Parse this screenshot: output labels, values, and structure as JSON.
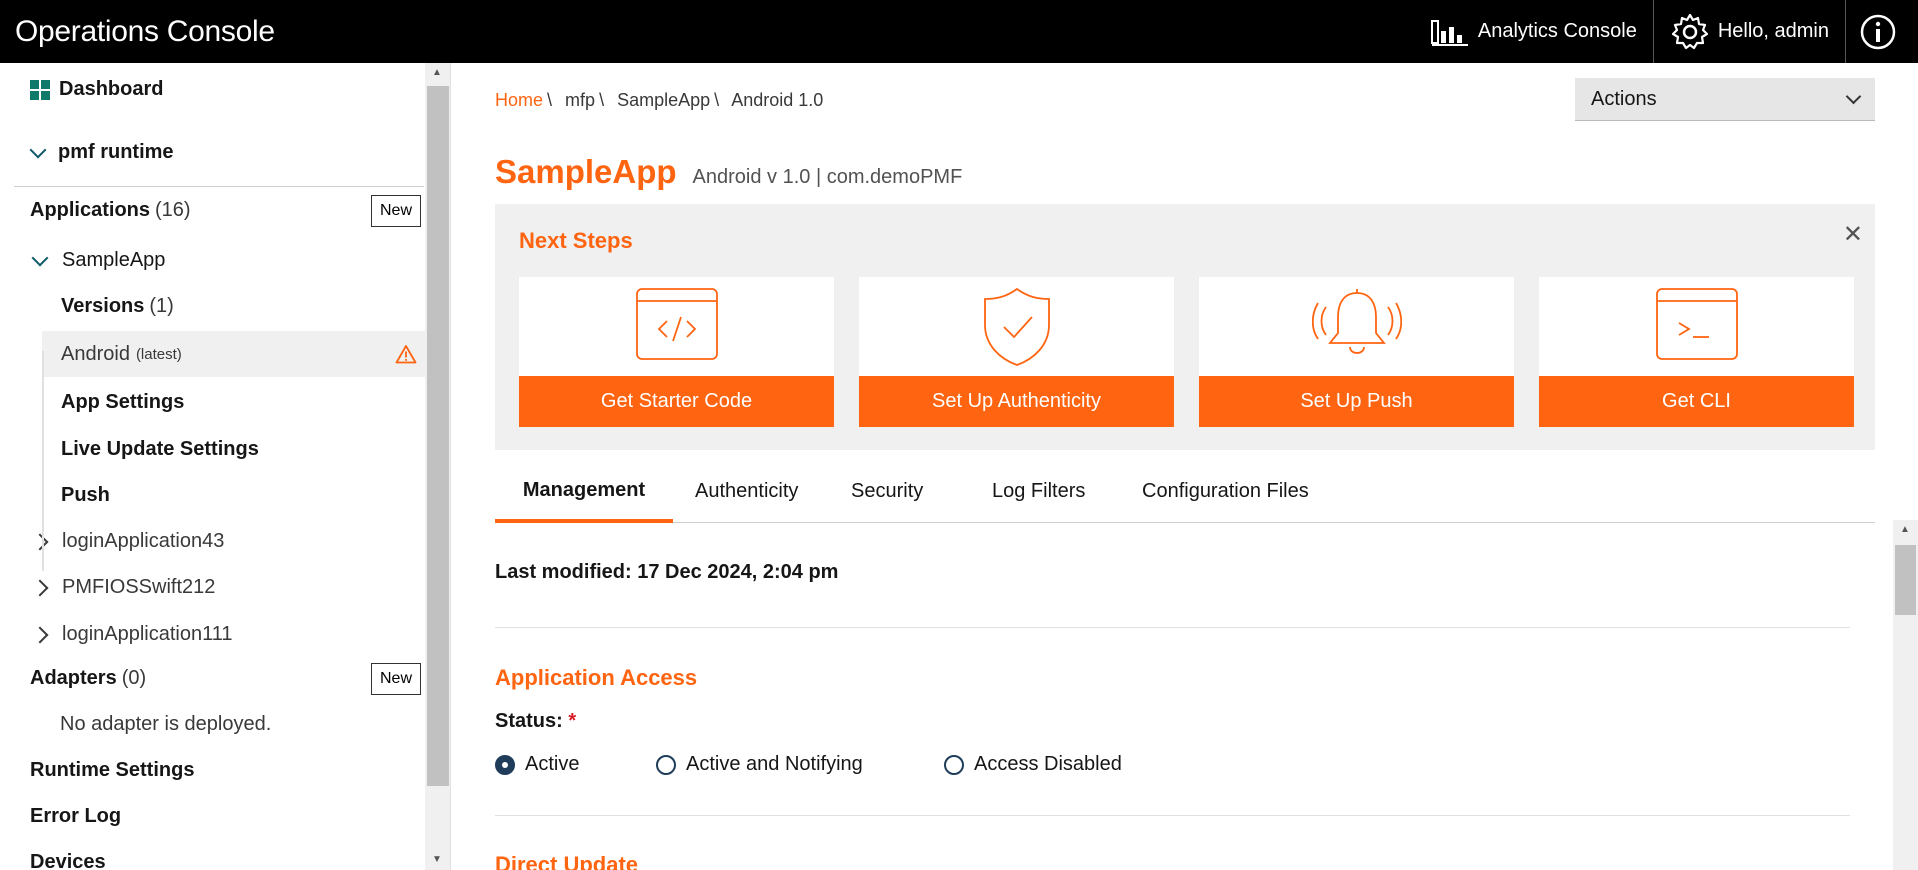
{
  "topbar": {
    "title": "Operations Console",
    "analytics_label": "Analytics Console",
    "user_label": "Hello, admin"
  },
  "sidebar": {
    "dashboard": "Dashboard",
    "runtime": "pmf runtime",
    "applications_label": "Applications",
    "applications_count": "(16)",
    "new_label": "New",
    "app_name": "SampleApp",
    "versions_label": "Versions",
    "versions_count": "(1)",
    "android_label": "Android",
    "android_tag": "(latest)",
    "app_settings": "App Settings",
    "live_update": "Live Update Settings",
    "push": "Push",
    "other_apps": [
      "loginApplication43",
      "PMFIOSSwift212",
      "loginApplication111"
    ],
    "adapters_label": "Adapters",
    "adapters_count": "(0)",
    "no_adapter": "No adapter is deployed.",
    "runtime_settings": "Runtime Settings",
    "error_log": "Error Log",
    "devices": "Devices"
  },
  "breadcrumb": {
    "items": [
      "Home",
      "mfp",
      "SampleApp",
      "Android 1.0"
    ],
    "separator": "\\"
  },
  "actions": {
    "label": "Actions"
  },
  "app_header": {
    "name": "SampleApp",
    "subtitle": "Android v 1.0 | com.demoPMF"
  },
  "next_steps": {
    "title": "Next Steps",
    "close": "✕",
    "cards": [
      {
        "label": "Get Starter Code",
        "icon": "code-window-icon"
      },
      {
        "label": "Set Up Authenticity",
        "icon": "shield-check-icon"
      },
      {
        "label": "Set Up Push",
        "icon": "bell-icon"
      },
      {
        "label": "Get CLI",
        "icon": "terminal-icon"
      }
    ]
  },
  "tabs": [
    "Management",
    "Authenticity",
    "Security",
    "Log Filters",
    "Configuration Files"
  ],
  "management": {
    "last_modified": "Last modified: 17 Dec 2024, 2:04 pm",
    "app_access_title": "Application Access",
    "status_label": "Status:",
    "required_mark": "*",
    "status_options": [
      "Active",
      "Active and Notifying",
      "Access Disabled"
    ],
    "status_selected": "Active",
    "direct_update_title": "Direct Update"
  },
  "colors": {
    "accent": "#ff6411",
    "topbar": "#000000",
    "teal": "#0f5a6a"
  }
}
